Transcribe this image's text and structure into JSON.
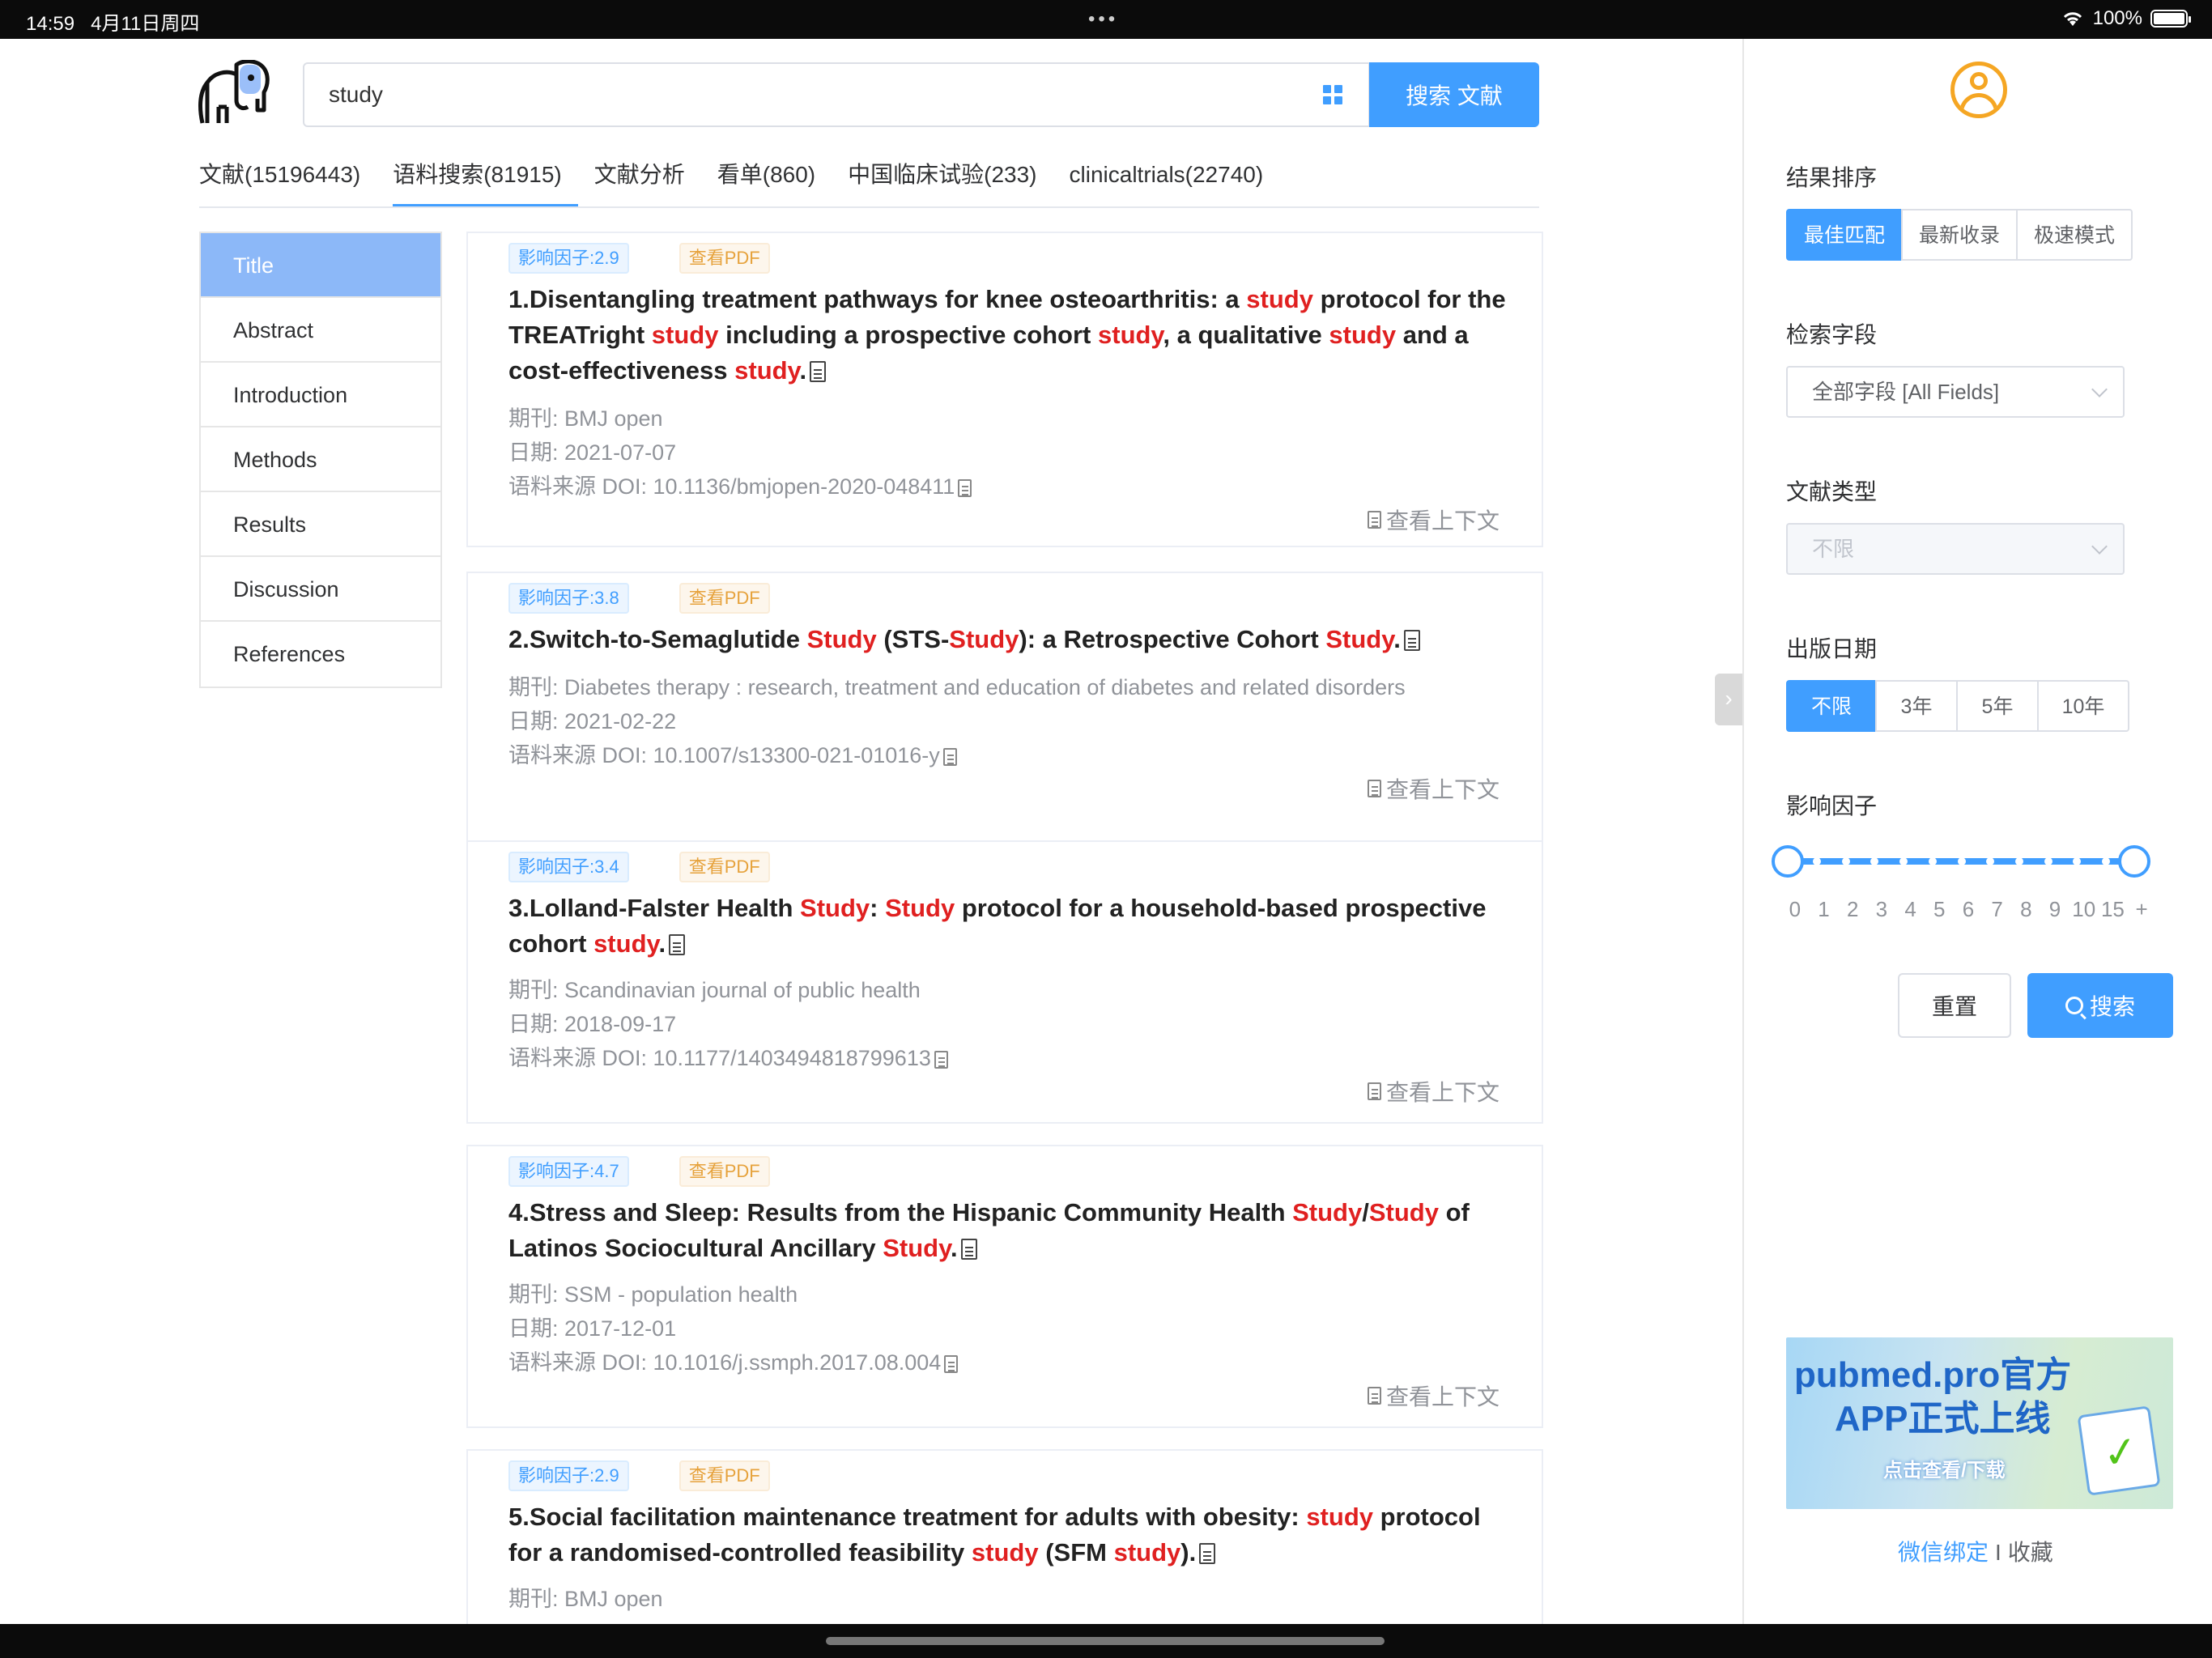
{
  "status_bar": {
    "time": "14:59",
    "date": "4月11日周四",
    "battery": "100%"
  },
  "search": {
    "query": "study",
    "button_label": "搜索 文献"
  },
  "tabs": [
    {
      "label": "文献(15196443)",
      "active": false
    },
    {
      "label": "语料搜索(81915)",
      "active": true
    },
    {
      "label": "文献分析",
      "active": false
    },
    {
      "label": "看单(860)",
      "active": false
    },
    {
      "label": "中国临床试验(233)",
      "active": false
    },
    {
      "label": "clinicaltrials(22740)",
      "active": false
    }
  ],
  "sections": [
    "Title",
    "Abstract",
    "Introduction",
    "Methods",
    "Results",
    "Discussion",
    "References"
  ],
  "results": [
    {
      "impact": "影响因子:2.9",
      "pdf": "查看PDF",
      "title_parts": [
        "1.Disentangling treatment pathways for knee osteoarthritis: a ",
        "study",
        " protocol for the TREATright ",
        "study",
        " including a prospective cohort ",
        "study",
        ", a qualitative ",
        "study",
        " and a cost-effectiveness ",
        "study",
        "."
      ],
      "journal": "期刊: BMJ open",
      "date": "日期: 2021-07-07",
      "doi": "语料来源 DOI: 10.1136/bmjopen-2020-048411",
      "context": "查看上下文"
    },
    {
      "impact": "影响因子:3.8",
      "pdf": "查看PDF",
      "title_parts": [
        "2.Switch-to-Semaglutide ",
        "Study",
        " (STS-",
        "Study",
        "): a Retrospective Cohort ",
        "Study",
        "."
      ],
      "journal": "期刊: Diabetes therapy : research, treatment and education of diabetes and related disorders",
      "date": "日期: 2021-02-22",
      "doi": "语料来源 DOI: 10.1007/s13300-021-01016-y",
      "context": "查看上下文"
    },
    {
      "impact": "影响因子:3.4",
      "pdf": "查看PDF",
      "title_parts": [
        "3.Lolland-Falster Health ",
        "Study",
        ": ",
        "Study",
        " protocol for a household-based prospective cohort ",
        "study",
        "."
      ],
      "journal": "期刊: Scandinavian journal of public health",
      "date": "日期: 2018-09-17",
      "doi": "语料来源 DOI: 10.1177/1403494818799613",
      "context": "查看上下文"
    },
    {
      "impact": "影响因子:4.7",
      "pdf": "查看PDF",
      "title_parts": [
        "4.Stress and Sleep: Results from the Hispanic Community Health ",
        "Study",
        "/",
        "Study",
        " of Latinos Sociocultural Ancillary ",
        "Study",
        "."
      ],
      "journal": "期刊: SSM - population health",
      "date": "日期: 2017-12-01",
      "doi": "语料来源 DOI: 10.1016/j.ssmph.2017.08.004",
      "context": "查看上下文"
    },
    {
      "impact": "影响因子:2.9",
      "pdf": "查看PDF",
      "title_parts": [
        "5.Social facilitation maintenance treatment for adults with obesity: ",
        "study",
        " protocol for a randomised-controlled feasibility ",
        "study",
        " (SFM ",
        "study",
        ")."
      ],
      "journal": "期刊: BMJ open",
      "date": "",
      "doi": "",
      "context": ""
    }
  ],
  "panel": {
    "sort_title": "结果排序",
    "sort_options": [
      "最佳匹配",
      "最新收录",
      "极速模式"
    ],
    "sort_selected": 0,
    "field_title": "检索字段",
    "field_value": "全部字段 [All Fields]",
    "type_title": "文献类型",
    "type_value": "不限",
    "date_title": "出版日期",
    "date_options": [
      "不限",
      "3年",
      "5年",
      "10年"
    ],
    "date_selected": 0,
    "if_title": "影响因子",
    "if_ticks": [
      "0",
      "1",
      "2",
      "3",
      "4",
      "5",
      "6",
      "7",
      "8",
      "9",
      "10",
      "15",
      "+"
    ],
    "if_range": [
      0,
      12
    ],
    "reset_label": "重置",
    "search_label": "搜索",
    "banner_line1": "pubmed.pro官方",
    "banner_line2": "APP正式上线",
    "banner_line3": "点击查看/下载",
    "wechat_label": "微信绑定",
    "separator": "I",
    "favorites_label": "收藏"
  },
  "colors": {
    "accent": "#409eff",
    "highlight": "#e02020",
    "pdf_badge": "#e6a23c"
  }
}
